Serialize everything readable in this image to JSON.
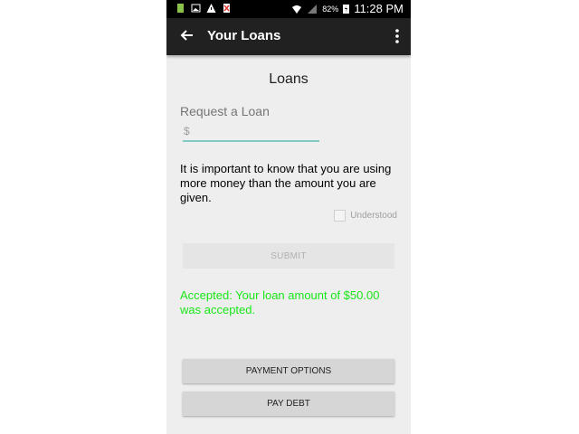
{
  "status_bar": {
    "icons": [
      "battery-saver-icon",
      "image-icon",
      "warning-icon",
      "no-sim-icon"
    ],
    "wifi_icon": "wifi-icon",
    "signal_icon": "signal-icon",
    "battery_percent": "82%",
    "time": "11:28 PM"
  },
  "app_bar": {
    "title": "Your Loans",
    "back_icon": "arrow-back-icon",
    "menu_icon": "more-vert-icon"
  },
  "main": {
    "heading": "Loans",
    "request_label": "Request a Loan",
    "amount_placeholder": "$",
    "amount_value": "",
    "info_text": "It is important to know that you are using more money than the amount you are given.",
    "understood_label": "Understood",
    "understood_checked": false,
    "submit_label": "SUBMIT",
    "accepted_message": "Accepted: Your loan amount of $50.00 was accepted.",
    "payment_options_label": "PAYMENT OPTIONS",
    "pay_debt_label": "PAY DEBT"
  },
  "colors": {
    "app_bar": "#212121",
    "accent_underline": "#80cbc4",
    "success": "#19e619"
  }
}
